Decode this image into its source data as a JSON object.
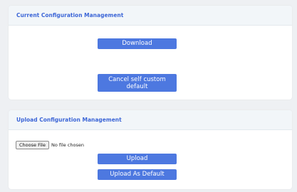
{
  "current_config": {
    "title": "Current Configuration Management",
    "download_label": "Download",
    "cancel_default_label": "Cancel self custom default"
  },
  "upload_config": {
    "title": "Upload Configuration Management",
    "choose_file_label": "Choose File",
    "no_file_text": "No file chosen",
    "upload_label": "Upload",
    "upload_default_label": "Upload As Default"
  },
  "colors": {
    "accent": "#4d78e0",
    "header_text": "#3c66d7",
    "header_bg": "#f2f6f9",
    "page_bg": "#eef0f3"
  }
}
